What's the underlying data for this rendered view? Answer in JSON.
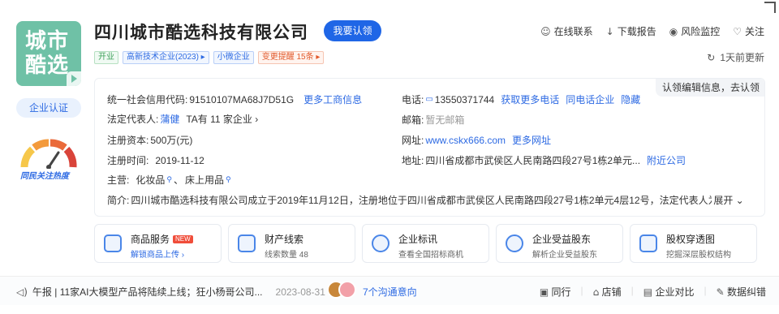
{
  "logo": {
    "line1": "城市",
    "line2": "酷选"
  },
  "auth_badge": "企业认证",
  "heat_label": "同民关注热度",
  "company_name": "四川城市酷选科技有限公司",
  "claim_button": "我要认领",
  "tags": [
    {
      "label": "开业",
      "style": "green"
    },
    {
      "label": "高新技术企业(2023) ▸",
      "style": "blue"
    },
    {
      "label": "小微企业",
      "style": "blue"
    },
    {
      "label": "变更提醒 15条 ▸",
      "style": "orange"
    }
  ],
  "top_actions": [
    {
      "icon": "chat-icon",
      "glyph": "☺",
      "label": "在线联系"
    },
    {
      "icon": "download-icon",
      "glyph": "↓",
      "label": "下载报告"
    },
    {
      "icon": "eye-icon",
      "glyph": "◉",
      "label": "风险监控"
    },
    {
      "icon": "heart-icon",
      "glyph": "♡",
      "label": "关注"
    }
  ],
  "updated": "1天前更新",
  "claim_edit": "认领编辑信息，去认领",
  "info": {
    "credit_code_label": "统一社会信用代码:",
    "credit_code": "91510107MA68J7D51G",
    "more_business": "更多工商信息",
    "legal_rep_label": "法定代表人:",
    "legal_rep": "蒲健",
    "legal_rep_extra": "TA有 11 家企业 ›",
    "capital_label": "注册资本:",
    "capital": "500万(元)",
    "reg_time_label": "注册时间:",
    "reg_time": "2019-11-12",
    "main_label": "主营:",
    "main_items": [
      "化妆品",
      "床上用品"
    ],
    "phone_label": "电话:",
    "phone": "13550371744",
    "more_phone": "获取更多电话",
    "same_phone": "同电话企业",
    "hide": "隐藏",
    "email_label": "邮箱:",
    "email": "暂无邮箱",
    "website_label": "网址:",
    "website": "www.cskx666.com",
    "more_website": "更多网址",
    "address_label": "地址:",
    "address": "四川省成都市武侯区人民南路四段27号1栋2单元...",
    "nearby": "附近公司",
    "intro_label": "简介:",
    "intro": "四川城市酷选科技有限公司成立于2019年11月12日，注册地位于四川省成都市武侯区人民南路四段27号1栋2单元4层12号，法定代表人为蒲...",
    "expand": "展开 ⌄"
  },
  "cards": [
    {
      "title": "商品服务",
      "badge": "NEW",
      "sub": "解锁商品上传 ›",
      "sub_blue": true
    },
    {
      "title": "财产线索",
      "badge": "",
      "sub": "线索数量 48",
      "sub_blue": false
    },
    {
      "title": "企业标讯",
      "badge": "",
      "sub": "查看全国招标商机",
      "sub_blue": false
    },
    {
      "title": "企业受益股东",
      "badge": "",
      "sub": "解析企业受益股东",
      "sub_blue": false
    },
    {
      "title": "股权穿透图",
      "badge": "",
      "sub": "挖掘深层股权结构",
      "sub_blue": false
    }
  ],
  "news": {
    "text": "午报 | 11家AI大模型产品将陆续上线；狂小杨哥公司...",
    "date": "2023-08-31"
  },
  "chat_link": "7个沟通意向",
  "bottom_actions": [
    "同行",
    "店铺",
    "企业对比",
    "数据纠错"
  ]
}
